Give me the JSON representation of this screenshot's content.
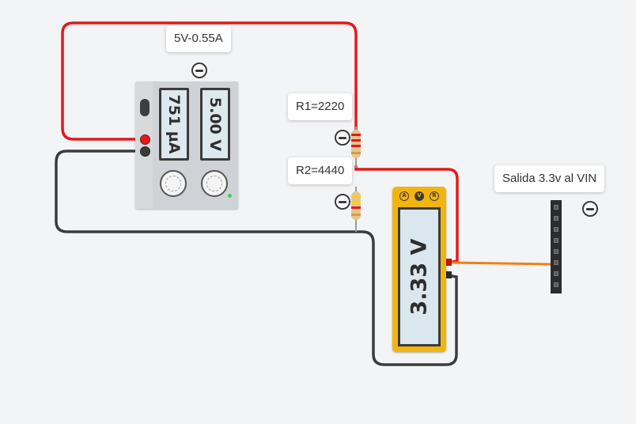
{
  "callouts": {
    "power_supply": "5V-0.55A",
    "r1": "R1=2220",
    "r2": "R2=4440",
    "output": "Salida 3.3v al VIN"
  },
  "power_supply": {
    "current_display": "751 µA",
    "voltage_display": "5.00 V"
  },
  "multimeter": {
    "reading": "3.33 V",
    "modes": [
      "A",
      "V",
      "R"
    ],
    "active_mode": "V"
  },
  "wire_colors": {
    "positive": "#e11b1b",
    "negative": "#3c3c3c",
    "signal": "#f07f1a"
  }
}
